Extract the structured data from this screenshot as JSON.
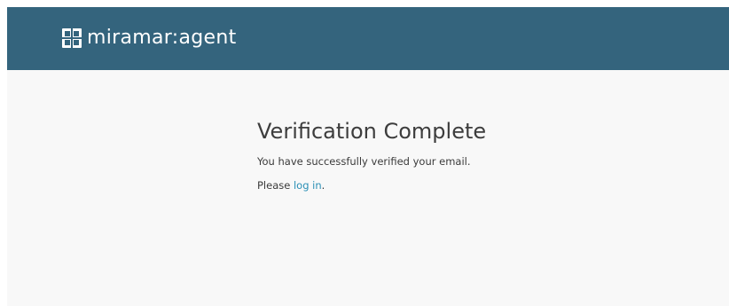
{
  "header": {
    "brand": "miramar:agent",
    "brand_icon": "miramar-logo-icon",
    "background_color": "#34647d"
  },
  "main": {
    "title": "Verification Complete",
    "message": "You have successfully verified your email.",
    "prompt_prefix": "Please ",
    "login_link": "log in",
    "prompt_suffix": ".",
    "link_color": "#2a8fb5"
  }
}
